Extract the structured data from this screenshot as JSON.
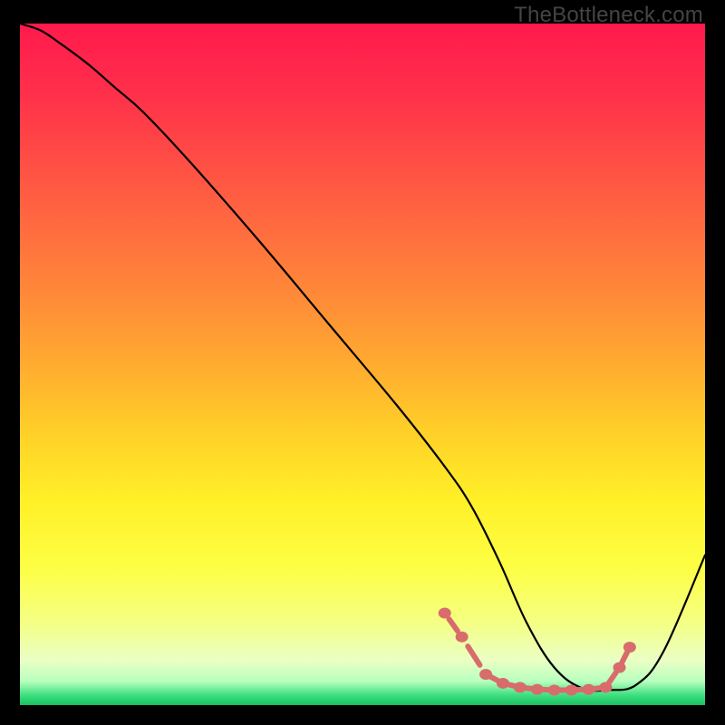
{
  "attribution": "TheBottleneck.com",
  "gradient": {
    "stops": [
      {
        "offset": 0.0,
        "color": "#ff1a4d"
      },
      {
        "offset": 0.1,
        "color": "#ff2f4a"
      },
      {
        "offset": 0.2,
        "color": "#ff4d45"
      },
      {
        "offset": 0.3,
        "color": "#ff6b3f"
      },
      {
        "offset": 0.4,
        "color": "#ff8a38"
      },
      {
        "offset": 0.5,
        "color": "#ffab30"
      },
      {
        "offset": 0.6,
        "color": "#ffd028"
      },
      {
        "offset": 0.7,
        "color": "#fff028"
      },
      {
        "offset": 0.8,
        "color": "#fdff45"
      },
      {
        "offset": 0.88,
        "color": "#f5ff85"
      },
      {
        "offset": 0.935,
        "color": "#e9ffc5"
      },
      {
        "offset": 0.965,
        "color": "#b8ffbe"
      },
      {
        "offset": 0.985,
        "color": "#40e080"
      },
      {
        "offset": 1.0,
        "color": "#18c060"
      }
    ]
  },
  "chart_data": {
    "type": "line",
    "title": "",
    "xlabel": "",
    "ylabel": "",
    "xlim": [
      0,
      100
    ],
    "ylim": [
      0,
      100
    ],
    "series": [
      {
        "name": "bottleneck-curve",
        "x": [
          0,
          3,
          6,
          10,
          14,
          18,
          25,
          35,
          45,
          55,
          62,
          66,
          70,
          74,
          78,
          82,
          86,
          90,
          94,
          100
        ],
        "y": [
          100,
          99,
          97,
          94,
          90.5,
          87,
          79.5,
          68,
          56,
          44,
          35,
          29,
          21,
          12,
          5.5,
          2.5,
          2.2,
          3,
          8,
          22
        ]
      }
    ],
    "markers": {
      "name": "highlight-dots",
      "color": "#d86c6c",
      "x": [
        62.0,
        64.5,
        68.0,
        70.5,
        73.0,
        75.5,
        78.0,
        80.5,
        83.0,
        85.5,
        87.5,
        89.0
      ],
      "y": [
        13.5,
        10.0,
        4.5,
        3.2,
        2.6,
        2.3,
        2.2,
        2.2,
        2.3,
        2.6,
        5.5,
        8.5
      ]
    }
  }
}
